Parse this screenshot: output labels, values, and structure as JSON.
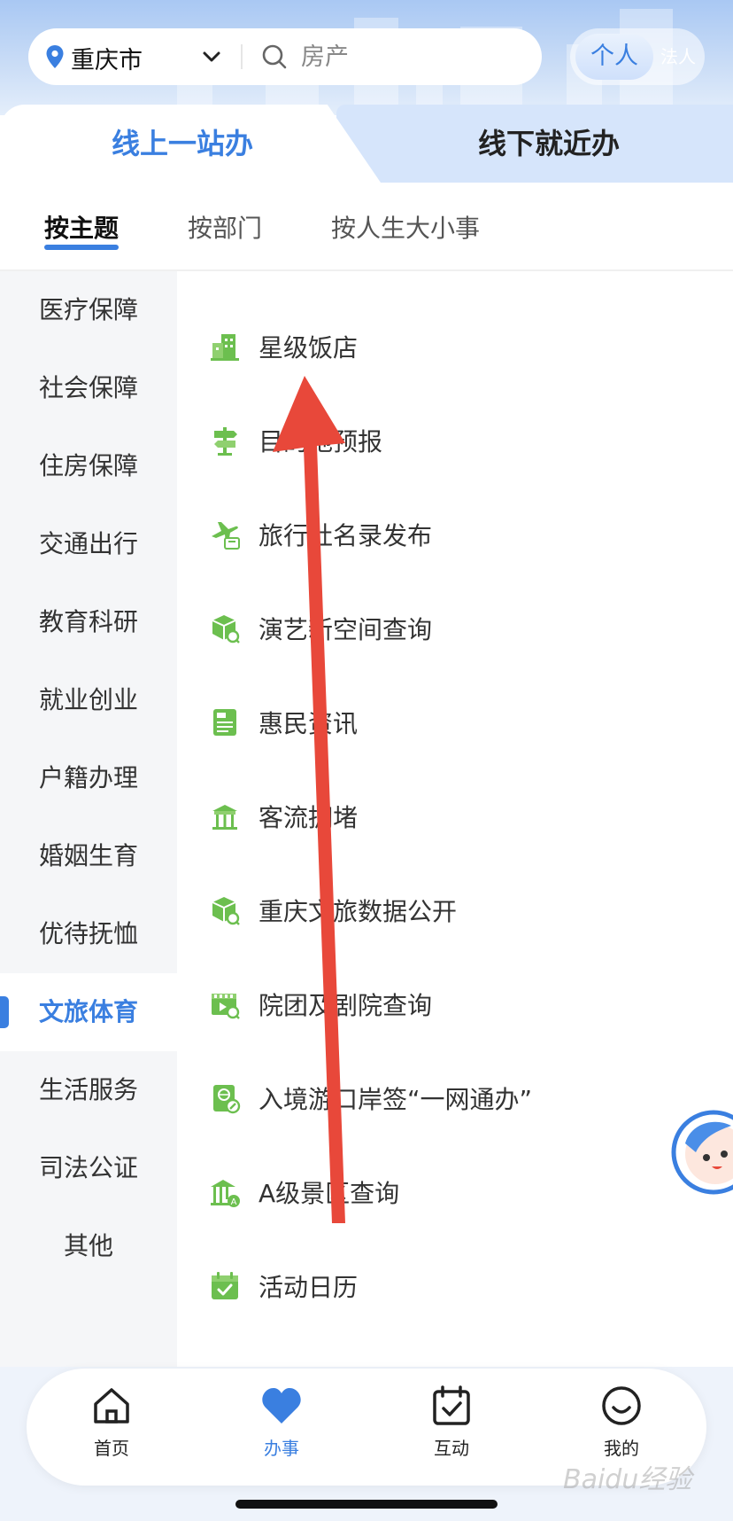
{
  "header": {
    "city": "重庆市",
    "search_placeholder": "房产",
    "toggle": {
      "active": "个人",
      "inactive": "法人"
    }
  },
  "main_tabs": [
    {
      "label": "线上一站办",
      "active": true
    },
    {
      "label": "线下就近办",
      "active": false
    }
  ],
  "sub_tabs": [
    {
      "label": "按主题",
      "active": true
    },
    {
      "label": "按部门",
      "active": false
    },
    {
      "label": "按人生大小事",
      "active": false
    }
  ],
  "sidebar": {
    "items": [
      {
        "label": "医疗保障"
      },
      {
        "label": "社会保障"
      },
      {
        "label": "住房保障"
      },
      {
        "label": "交通出行"
      },
      {
        "label": "教育科研"
      },
      {
        "label": "就业创业"
      },
      {
        "label": "户籍办理"
      },
      {
        "label": "婚姻生育"
      },
      {
        "label": "优待抚恤"
      },
      {
        "label": "文旅体育",
        "active": true
      },
      {
        "label": "生活服务"
      },
      {
        "label": "司法公证"
      },
      {
        "label": "其他"
      }
    ]
  },
  "list": {
    "items": [
      {
        "label": "星级饭店",
        "icon": "hotel-icon"
      },
      {
        "label": "目的地预报",
        "icon": "signpost-icon"
      },
      {
        "label": "旅行社名录发布",
        "icon": "travel-agency-icon"
      },
      {
        "label": "演艺新空间查询",
        "icon": "box-search-icon"
      },
      {
        "label": "惠民资讯",
        "icon": "news-icon"
      },
      {
        "label": "客流拥堵",
        "icon": "crowd-icon"
      },
      {
        "label": "重庆文旅数据公开",
        "icon": "box-search-icon"
      },
      {
        "label": "院团及剧院查询",
        "icon": "theater-search-icon"
      },
      {
        "label": "入境游口岸签“一网通办”",
        "icon": "entry-visa-icon"
      },
      {
        "label": "A级景区查询",
        "icon": "scenic-spot-icon"
      },
      {
        "label": "活动日历",
        "icon": "calendar-icon"
      }
    ]
  },
  "bottom_nav": [
    {
      "label": "首页",
      "icon": "home-icon"
    },
    {
      "label": "办事",
      "icon": "heart-icon",
      "active": true
    },
    {
      "label": "互动",
      "icon": "calendar-check-icon"
    },
    {
      "label": "我的",
      "icon": "smile-icon"
    }
  ],
  "watermark": "Baidu经验",
  "colors": {
    "accent": "#3a7fe0",
    "icon_green": "#6cbf4f",
    "arrow": "#e8483a"
  }
}
